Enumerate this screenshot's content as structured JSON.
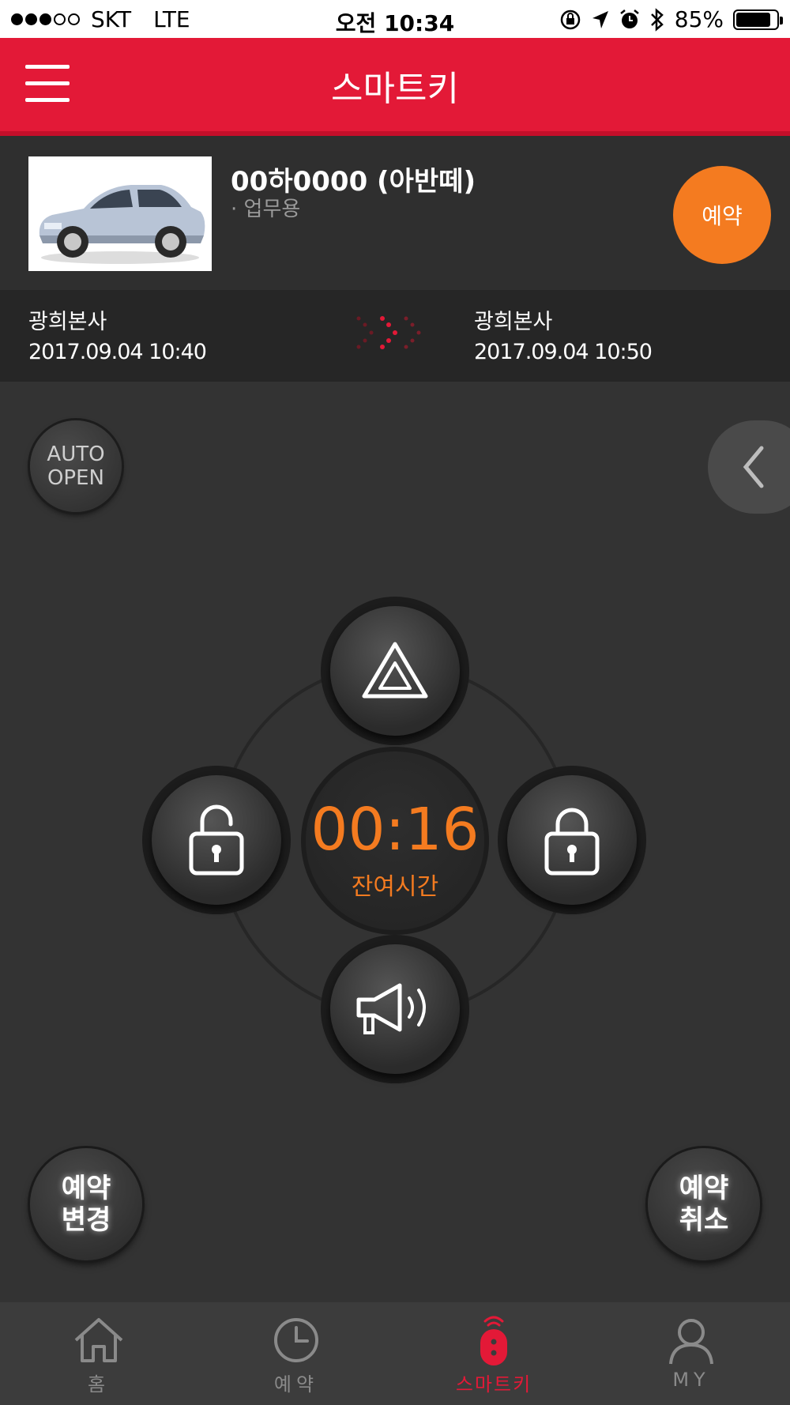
{
  "status_bar": {
    "carrier": "SKT",
    "network": "LTE",
    "time": "오전 10:34",
    "battery": "85%",
    "battery_level": 0.85,
    "signal_bars": 3
  },
  "header": {
    "title": "스마트키"
  },
  "vehicle": {
    "name": "00하0000 (아반떼)",
    "type": "· 업무용",
    "reserve_button": "예약"
  },
  "route": {
    "from": {
      "place": "광희본사",
      "datetime": "2017.09.04 10:40"
    },
    "to": {
      "place": "광희본사",
      "datetime": "2017.09.04 10:50"
    }
  },
  "controls": {
    "auto_open_line1": "AUTO",
    "auto_open_line2": "OPEN",
    "timer": "00:16",
    "timer_label": "잔여시간",
    "change_line1": "예약",
    "change_line2": "변경",
    "cancel_line1": "예약",
    "cancel_line2": "취소"
  },
  "tabs": [
    {
      "label": "홈",
      "icon": "home-icon"
    },
    {
      "label": "예약",
      "icon": "clock-icon"
    },
    {
      "label": "스마트키",
      "icon": "smart-key-icon",
      "active": true
    },
    {
      "label": "MY",
      "icon": "person-icon"
    }
  ],
  "colors": {
    "brand_red": "#e31937",
    "accent_orange": "#f47b20",
    "background": "#333333"
  }
}
